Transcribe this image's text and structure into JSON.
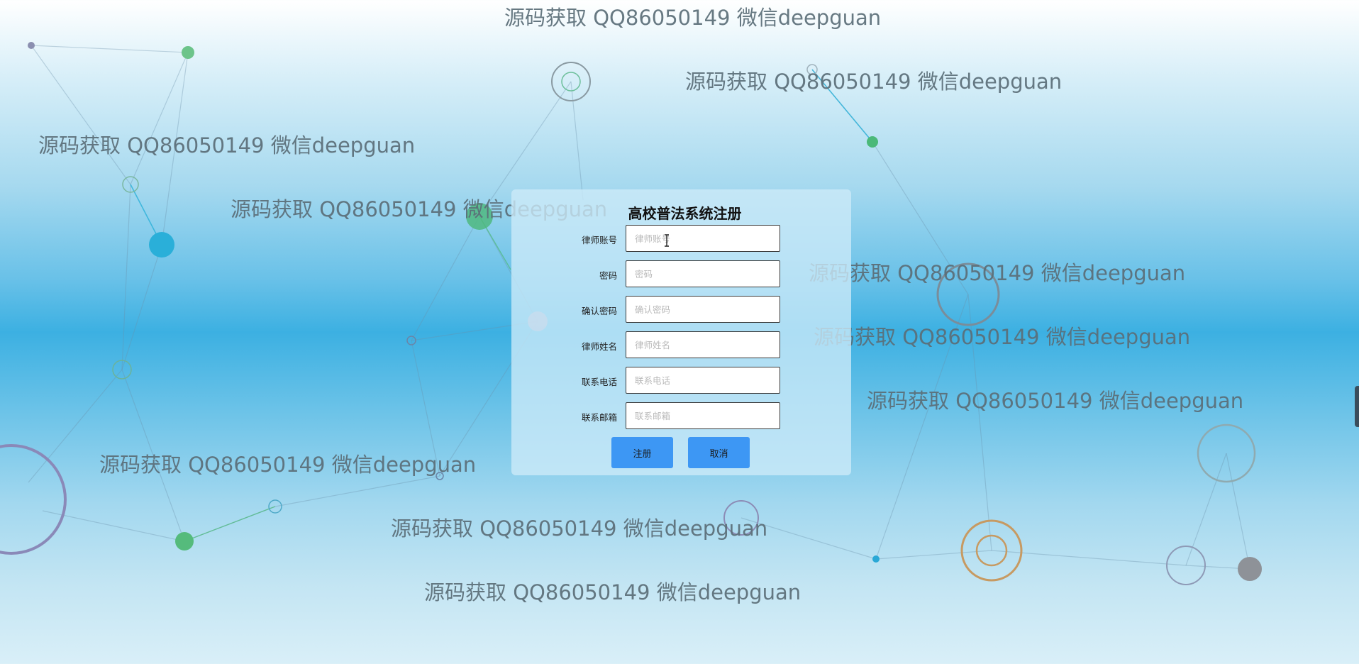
{
  "watermark_text": "源码获取 QQ86050149 微信deepguan",
  "form": {
    "title": "高校普法系统注册",
    "fields": [
      {
        "label": "律师账号",
        "placeholder": "律师账号",
        "value": ""
      },
      {
        "label": "密码",
        "placeholder": "密码",
        "value": ""
      },
      {
        "label": "确认密码",
        "placeholder": "确认密码",
        "value": ""
      },
      {
        "label": "律师姓名",
        "placeholder": "律师姓名",
        "value": ""
      },
      {
        "label": "联系电话",
        "placeholder": "联系电话",
        "value": ""
      },
      {
        "label": "联系邮箱",
        "placeholder": "联系邮箱",
        "value": ""
      }
    ],
    "register_label": "注册",
    "cancel_label": "取消"
  },
  "colors": {
    "button": "#3d97f4",
    "panel": "rgba(205,235,248,0.78)",
    "watermark": "#5b6e78",
    "background_mid": "#3cb0e2"
  },
  "icons": {
    "text_cursor": "i-beam-cursor-icon"
  }
}
